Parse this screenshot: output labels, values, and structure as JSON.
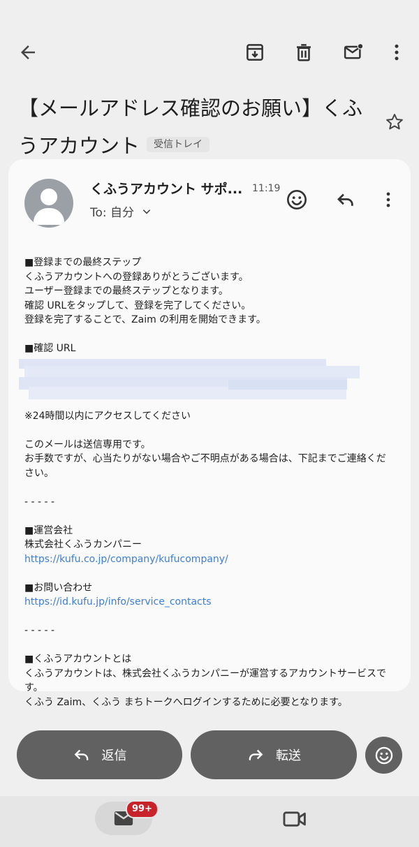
{
  "toolbar": {
    "back_icon": "arrow-back-icon",
    "archive_icon": "archive-icon",
    "delete_icon": "trash-icon",
    "mark_unread_icon": "mark-unread-icon",
    "more_icon": "more-vert-icon"
  },
  "subject": {
    "title": "【メールアドレス確認のお願い】くふうアカウント",
    "label": "受信トレイ",
    "star_icon": "star-outline-icon"
  },
  "message": {
    "sender": "くふうアカウント サポ...",
    "time": "11:19",
    "to": "To: 自分",
    "body": {
      "s1_heading": "■登録までの最終ステップ",
      "s1_l1": "くふうアカウントへの登録ありがとうございます。",
      "s1_l2": "ユーザー登録までの最終ステップとなります。",
      "s1_l3": "確認 URLをタップして、登録を完了してください。",
      "s1_l4": "登録を完了することで、Zaim の利用を開始できます。",
      "s2_heading": "■確認 URL",
      "s2_note": "※24時間以内にアクセスしてください",
      "s3_l1": "このメールは送信専用です。",
      "s3_l2": "お手数ですが、心当たりがない場合やご不明点がある場合は、下記までご連絡ください。",
      "divider": "- - - - -",
      "s4_heading": "■運営会社",
      "s4_company": "株式会社くふうカンパニー",
      "s4_link": "https://kufu.co.jp/company/kufucompany/",
      "s5_heading": "■お問い合わせ",
      "s5_link": "https://id.kufu.jp/info/service_contacts",
      "s6_heading": "■くふうアカウントとは",
      "s6_l1": "くふうアカウントは、株式会社くふうカンパニーが運営するアカウントサービスです。",
      "s6_l2": "くふう Zaim、くふう まちトークへログインするために必要となります。"
    }
  },
  "actions": {
    "reply_label": "返信",
    "forward_label": "転送"
  },
  "nav": {
    "mail_badge": "99+"
  },
  "colors": {
    "background": "#efefef",
    "card": "#fafafa",
    "link": "#3d7ed6",
    "pill": "#616161",
    "badge": "#c8232b"
  }
}
